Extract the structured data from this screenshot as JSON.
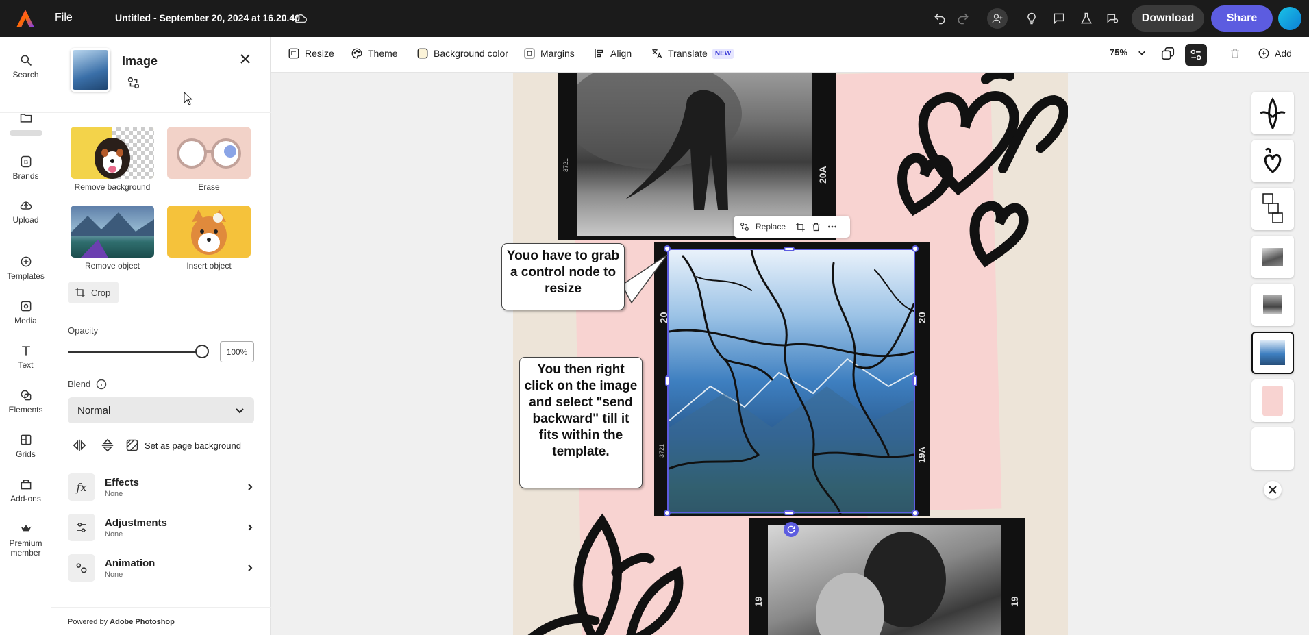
{
  "topbar": {
    "file_label": "File",
    "doc_title": "Untitled - September 20, 2024 at 16.20.40",
    "download_label": "Download",
    "share_label": "Share"
  },
  "left_rail": {
    "items": [
      {
        "label": "Search",
        "icon": "search-icon"
      },
      {
        "label": "",
        "icon": "folder-icon"
      },
      {
        "label": "Brands",
        "icon": "brands-icon"
      },
      {
        "label": "Upload",
        "icon": "upload-icon"
      },
      {
        "label": "Templates",
        "icon": "templates-icon"
      },
      {
        "label": "Media",
        "icon": "media-icon"
      },
      {
        "label": "Text",
        "icon": "text-icon"
      },
      {
        "label": "Elements",
        "icon": "elements-icon"
      },
      {
        "label": "Grids",
        "icon": "grids-icon"
      },
      {
        "label": "Add-ons",
        "icon": "addons-icon"
      },
      {
        "label": "Premium member",
        "icon": "premium-icon"
      }
    ]
  },
  "panel": {
    "title": "Image",
    "tools": [
      {
        "label": "Remove background"
      },
      {
        "label": "Erase"
      },
      {
        "label": "Remove object"
      },
      {
        "label": "Insert object"
      }
    ],
    "crop_label": "Crop",
    "opacity_label": "Opacity",
    "opacity_value": "100%",
    "opacity_level": 1.0,
    "blend_label": "Blend",
    "blend_value": "Normal",
    "page_bg_label": "Set as page background",
    "sections": [
      {
        "title": "Effects",
        "sub": "None"
      },
      {
        "title": "Adjustments",
        "sub": "None"
      },
      {
        "title": "Animation",
        "sub": "None"
      }
    ],
    "powered_prefix": "Powered by ",
    "powered_brand": "Adobe Photoshop"
  },
  "toolbar": {
    "items": [
      {
        "label": "Resize"
      },
      {
        "label": "Theme"
      },
      {
        "label": "Background color"
      },
      {
        "label": "Margins"
      },
      {
        "label": "Align"
      },
      {
        "label": "Translate"
      }
    ],
    "new_badge": "NEW",
    "zoom": "75%",
    "add_label": "Add"
  },
  "canvas": {
    "context_replace": "Replace",
    "frame_numbers": {
      "top_left": "3721",
      "top_right": "20A",
      "sel_left": "20",
      "sel_right": "20",
      "sel_bl": "3721",
      "sel_br": "19A",
      "bot_left": "19",
      "bot_right": "19"
    },
    "callout1": "Youo have to grab a control node to resize",
    "callout2": "You then right click on the image and select \"send backward\" till it fits within the template."
  },
  "colors": {
    "accent": "#5c5ce0",
    "topbar": "#1b1b1b",
    "page_pink": "#f8d3d1",
    "page_beige": "#ede4d8"
  }
}
